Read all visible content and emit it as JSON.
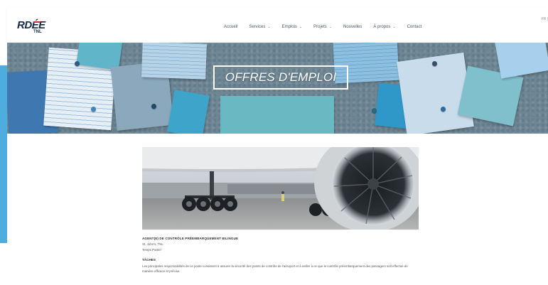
{
  "brand": {
    "logo_main": "RDÉE",
    "logo_sub": "TNL"
  },
  "nav": {
    "items": [
      {
        "label": "Accueil",
        "has_dropdown": false
      },
      {
        "label": "Services",
        "has_dropdown": true
      },
      {
        "label": "Emplois",
        "has_dropdown": true
      },
      {
        "label": "Projets",
        "has_dropdown": true
      },
      {
        "label": "Nouvelles",
        "has_dropdown": false
      },
      {
        "label": "À propos",
        "has_dropdown": true
      },
      {
        "label": "Contact",
        "has_dropdown": false
      }
    ],
    "chevron_glyph": "⌄"
  },
  "lang_switch": "FR | ",
  "hero": {
    "title": "OFFRES D'EMPLOI"
  },
  "job": {
    "title": "AGENT(E) DE CONTRÔLE PRÉEMBARQUEMENT BILINGUE",
    "location": "St. John's, TNL",
    "type": "Temps Partiel",
    "section_title": "TÂCHES",
    "description": "Les principales responsabilités de ce poste consistent à assurer la sécurité des points de contrôle de l'aéroport et à veiller à ce que le contrôle préembarquement des passagers soit effectué de manière efficace et précise."
  },
  "colors": {
    "accent": "#2f9fd8",
    "brand_navy": "#0f2b48",
    "brand_red": "#d62b2b",
    "hero_bg": "#6e8796"
  }
}
